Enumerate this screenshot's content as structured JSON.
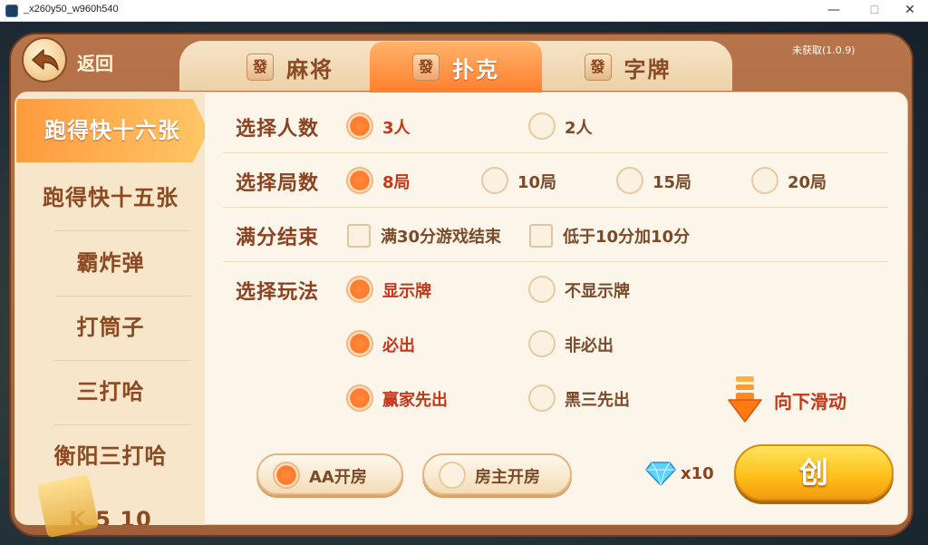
{
  "window": {
    "title": "_x260y50_w960h540",
    "version": "未获取(1.0.9)",
    "minimize": "—",
    "maximize": "☐",
    "close": "✕"
  },
  "header": {
    "back_label": "返回"
  },
  "tabs": [
    {
      "glyph": "發",
      "label": "麻将",
      "active": false
    },
    {
      "glyph": "發",
      "label": "扑克",
      "active": true
    },
    {
      "glyph": "發",
      "label": "字牌",
      "active": false
    }
  ],
  "sidebar": {
    "items": [
      {
        "label": "跑得快十六张",
        "active": true
      },
      {
        "label": "跑得快十五张",
        "active": false
      },
      {
        "label": "霸炸弹",
        "active": false
      },
      {
        "label": "打筒子",
        "active": false
      },
      {
        "label": "三打哈",
        "active": false
      },
      {
        "label": "衡阳三打哈",
        "active": false
      },
      {
        "label": "K 5 10",
        "active": false
      }
    ]
  },
  "options": {
    "players": {
      "label": "选择人数",
      "choices": [
        {
          "text": "3人",
          "selected": true
        },
        {
          "text": "2人",
          "selected": false
        }
      ]
    },
    "rounds": {
      "label": "选择局数",
      "choices": [
        {
          "text": "8局",
          "selected": true
        },
        {
          "text": "10局",
          "selected": false
        },
        {
          "text": "15局",
          "selected": false
        },
        {
          "text": "20局",
          "selected": false
        }
      ]
    },
    "full_score": {
      "label": "满分结束",
      "choices": [
        {
          "text": "满30分游戏结束",
          "checked": false
        },
        {
          "text": "低于10分加10分",
          "checked": false
        }
      ]
    },
    "play_mode": {
      "label": "选择玩法",
      "rows": [
        [
          {
            "text": "显示牌",
            "selected": true
          },
          {
            "text": "不显示牌",
            "selected": false
          }
        ],
        [
          {
            "text": "必出",
            "selected": true
          },
          {
            "text": "非必出",
            "selected": false
          }
        ],
        [
          {
            "text": "赢家先出",
            "selected": true
          },
          {
            "text": "黑三先出",
            "selected": false
          }
        ]
      ]
    }
  },
  "scroll_hint": "向下滑动",
  "footer": {
    "room_modes": [
      {
        "text": "AA开房",
        "selected": true
      },
      {
        "text": "房主开房",
        "selected": false
      }
    ],
    "cost": "x10",
    "create_label": "创"
  },
  "colors": {
    "accent": "#ff7a2a",
    "frame": "#a9663d",
    "panel": "#fcf6ea",
    "text_brown": "#8a4221",
    "selected_text": "#c4371a"
  }
}
